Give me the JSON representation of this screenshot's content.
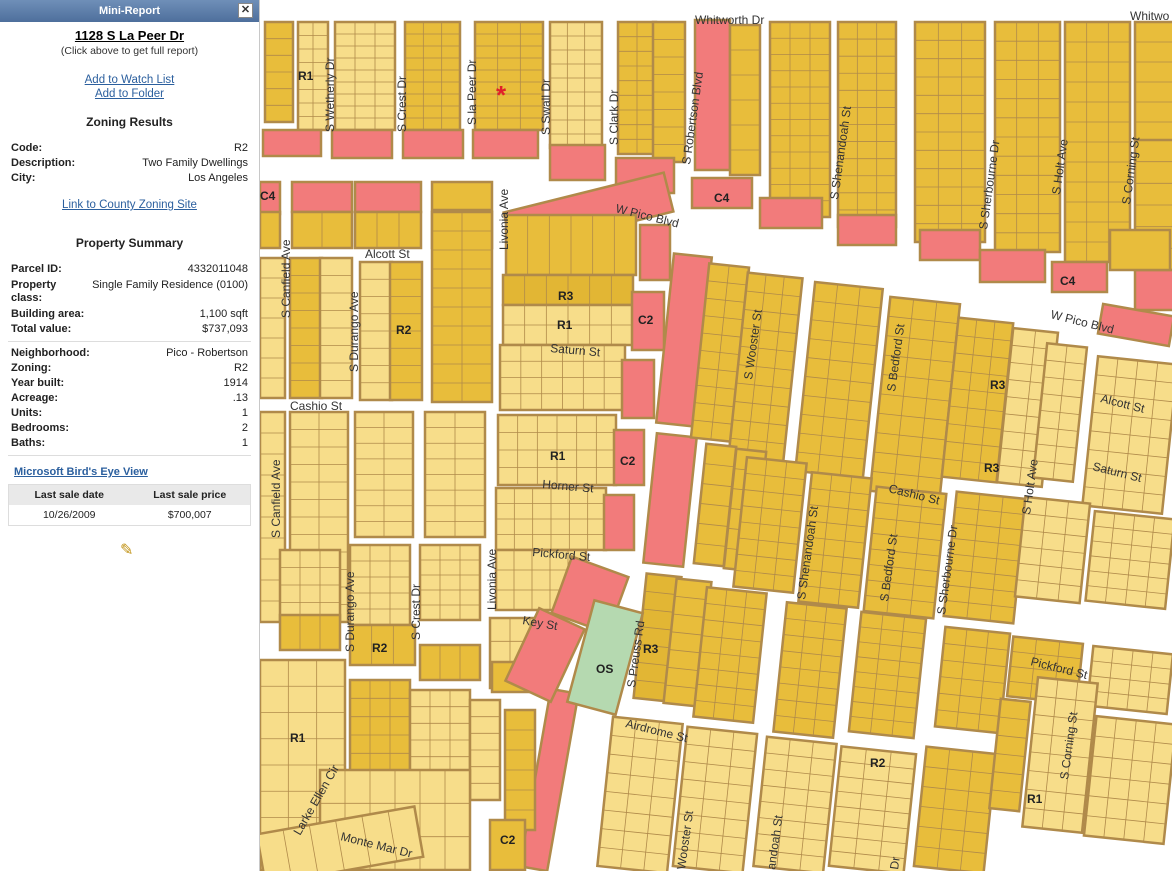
{
  "panel": {
    "title": "Mini-Report",
    "close_icon": "close-icon",
    "address": "1128 S La Peer Dr",
    "address_hint": "(Click above to get full report)",
    "watch_link": "Add to Watch List",
    "folder_link": "Add to Folder",
    "zoning_title": "Zoning Results",
    "zoning": {
      "code_label": "Code:",
      "code": "R2",
      "desc_label": "Description:",
      "desc": "Two Family Dwellings",
      "city_label": "City:",
      "city": "Los Angeles"
    },
    "county_link": "Link to County Zoning Site",
    "summary_title": "Property Summary",
    "summary": {
      "parcel_label": "Parcel ID:",
      "parcel": "4332011048",
      "class_label": "Property class:",
      "class": "Single Family Residence (0100)",
      "area_label": "Building area:",
      "area": "1,100 sqft",
      "value_label": "Total value:",
      "value": "$737,093",
      "neigh_label": "Neighborhood:",
      "neigh": "Pico - Robertson",
      "zoning_label": "Zoning:",
      "zoning": "R2",
      "year_label": "Year built:",
      "year": "1914",
      "acre_label": "Acreage:",
      "acre": ".13",
      "units_label": "Units:",
      "units": "1",
      "bed_label": "Bedrooms:",
      "bed": "2",
      "bath_label": "Baths:",
      "bath": "1"
    },
    "birds_eye": "Microsoft Bird's Eye View",
    "sale": {
      "date_header": "Last sale date",
      "price_header": "Last sale price",
      "date": "10/26/2009",
      "price": "$700,007"
    },
    "pencil_icon": "pencil-icon"
  },
  "map": {
    "colors": {
      "street": "#ffffff",
      "r1": "#f7dd8a",
      "r2": "#e8bd3b",
      "r3": "#e2b634",
      "commercial": "#f27b7b",
      "open_space": "#b5d9b0",
      "lot_line": "#b08a4a",
      "marker": "#e0202a"
    },
    "streets": [
      "Whitworth Dr",
      "Whitwo",
      "W Pico Blvd",
      "W Pico Blvd",
      "S Wetherly Dr",
      "S Crest Dr",
      "S la Peer Dr",
      "S Swall Dr",
      "S Clark Dr",
      "S Robertson Blvd",
      "S Shenandoah St",
      "S Sherbourne Dr",
      "S Holt Ave",
      "S Corning St",
      "Alcott St",
      "Alcott St",
      "Livonia Ave",
      "S Canfield Ave",
      "S Durango Ave",
      "Saturn St",
      "Saturn St",
      "S Wooster St",
      "S Bedford St",
      "Cashio St",
      "Cashio St",
      "Horner St",
      "S Canfield Ave",
      "Pickford St",
      "Pickford St",
      "Key St",
      "Livonia Ave",
      "S Durango Ave",
      "S Crest Dr",
      "S Preuss Rd",
      "S Shenandoah St",
      "S Bedford St",
      "S Sherbourne Dr",
      "S Holt Ave",
      "Airdrome St",
      "Larke Ellen Cir",
      "Monte Mar Dr",
      "Wooster St",
      "andoah St",
      "S Corning St",
      "Dr"
    ],
    "zones": [
      "R1",
      "C4",
      "C4",
      "C4",
      "R3",
      "R1",
      "C2",
      "R2",
      "R3",
      "C2",
      "R1",
      "R3",
      "R2",
      "OS",
      "R3",
      "R1",
      "R2",
      "R1",
      "C2"
    ]
  }
}
